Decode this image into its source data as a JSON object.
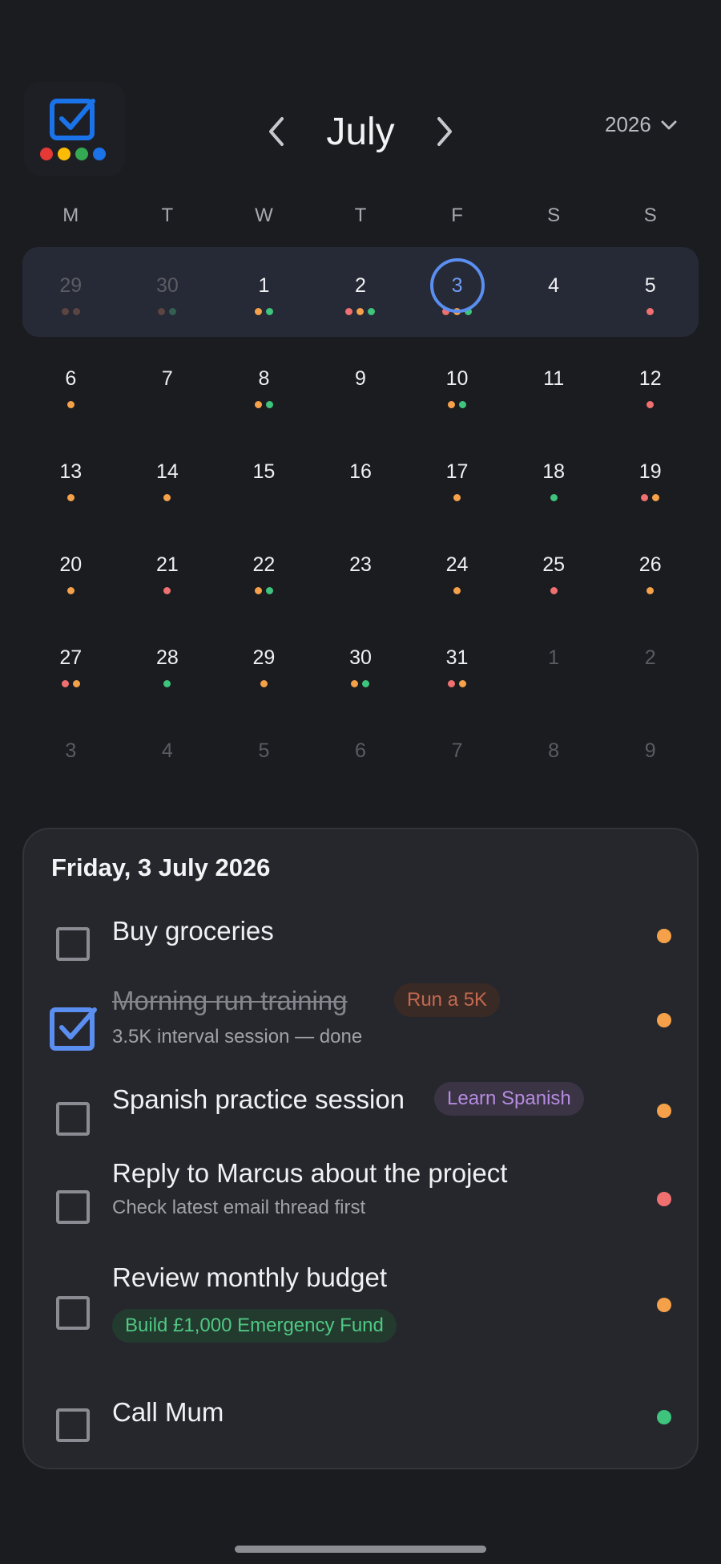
{
  "header": {
    "month": "July",
    "year": "2026",
    "app_dot_colors": [
      "#e53935",
      "#fbbc05",
      "#34a853",
      "#1a73e8"
    ]
  },
  "colors": {
    "orange": "#f5a14a",
    "green": "#3ec47c",
    "red": "#f07070",
    "brown": "#8a5a4a",
    "teal": "#3f8a66",
    "accent": "#5a8ef0"
  },
  "calendar": {
    "weekdays": [
      "M",
      "T",
      "W",
      "T",
      "F",
      "S",
      "S"
    ],
    "weeks": [
      [
        {
          "d": "29",
          "m": true,
          "dots": [
            "brown",
            "brown"
          ]
        },
        {
          "d": "30",
          "m": true,
          "dots": [
            "brown",
            "teal"
          ]
        },
        {
          "d": "1",
          "dots": [
            "orange",
            "green"
          ]
        },
        {
          "d": "2",
          "dots": [
            "red",
            "orange",
            "green"
          ]
        },
        {
          "d": "3",
          "sel": true,
          "dots": [
            "red",
            "orange",
            "green"
          ]
        },
        {
          "d": "4",
          "dots": []
        },
        {
          "d": "5",
          "dots": [
            "red"
          ]
        }
      ],
      [
        {
          "d": "6",
          "dots": [
            "orange"
          ]
        },
        {
          "d": "7",
          "dots": []
        },
        {
          "d": "8",
          "dots": [
            "orange",
            "green"
          ]
        },
        {
          "d": "9",
          "dots": []
        },
        {
          "d": "10",
          "dots": [
            "orange",
            "green"
          ]
        },
        {
          "d": "11",
          "dots": []
        },
        {
          "d": "12",
          "dots": [
            "red"
          ]
        }
      ],
      [
        {
          "d": "13",
          "dots": [
            "orange"
          ]
        },
        {
          "d": "14",
          "dots": [
            "orange"
          ]
        },
        {
          "d": "15",
          "dots": []
        },
        {
          "d": "16",
          "dots": []
        },
        {
          "d": "17",
          "dots": [
            "orange"
          ]
        },
        {
          "d": "18",
          "dots": [
            "green"
          ]
        },
        {
          "d": "19",
          "dots": [
            "red",
            "orange"
          ]
        }
      ],
      [
        {
          "d": "20",
          "dots": [
            "orange"
          ]
        },
        {
          "d": "21",
          "dots": [
            "red"
          ]
        },
        {
          "d": "22",
          "dots": [
            "orange",
            "green"
          ]
        },
        {
          "d": "23",
          "dots": []
        },
        {
          "d": "24",
          "dots": [
            "orange"
          ]
        },
        {
          "d": "25",
          "dots": [
            "red"
          ]
        },
        {
          "d": "26",
          "dots": [
            "orange"
          ]
        }
      ],
      [
        {
          "d": "27",
          "dots": [
            "red",
            "orange"
          ]
        },
        {
          "d": "28",
          "dots": [
            "green"
          ]
        },
        {
          "d": "29",
          "dots": [
            "orange"
          ]
        },
        {
          "d": "30",
          "dots": [
            "orange",
            "green"
          ]
        },
        {
          "d": "31",
          "dots": [
            "red",
            "orange"
          ]
        },
        {
          "d": "1",
          "m": true,
          "dots": []
        },
        {
          "d": "2",
          "m": true,
          "dots": []
        }
      ],
      [
        {
          "d": "3",
          "m": true,
          "dots": []
        },
        {
          "d": "4",
          "m": true,
          "dots": []
        },
        {
          "d": "5",
          "m": true,
          "dots": []
        },
        {
          "d": "6",
          "m": true,
          "dots": []
        },
        {
          "d": "7",
          "m": true,
          "dots": []
        },
        {
          "d": "8",
          "m": true,
          "dots": []
        },
        {
          "d": "9",
          "m": true,
          "dots": []
        }
      ]
    ]
  },
  "agenda": {
    "date": "Friday, 3 July 2026",
    "tasks": [
      {
        "title": "Buy groceries",
        "subtitle": "",
        "tag": "",
        "done": false,
        "priority": "orange"
      },
      {
        "title": "Morning run training",
        "subtitle": "3.5K interval session — done",
        "tag": "Run a 5K",
        "done": true,
        "priority": "orange"
      },
      {
        "title": "Spanish practice session",
        "subtitle": "",
        "tag": "Learn Spanish",
        "done": false,
        "priority": "orange"
      },
      {
        "title": "Reply to Marcus about the project",
        "subtitle": "Check latest email thread first",
        "tag": "",
        "done": false,
        "priority": "red"
      },
      {
        "title": "Review monthly budget",
        "subtitle": "",
        "tag": "Build £1,000 Emergency Fund",
        "done": false,
        "priority": "orange"
      },
      {
        "title": "Call Mum",
        "subtitle": "",
        "tag": "",
        "done": false,
        "priority": "green"
      }
    ]
  }
}
